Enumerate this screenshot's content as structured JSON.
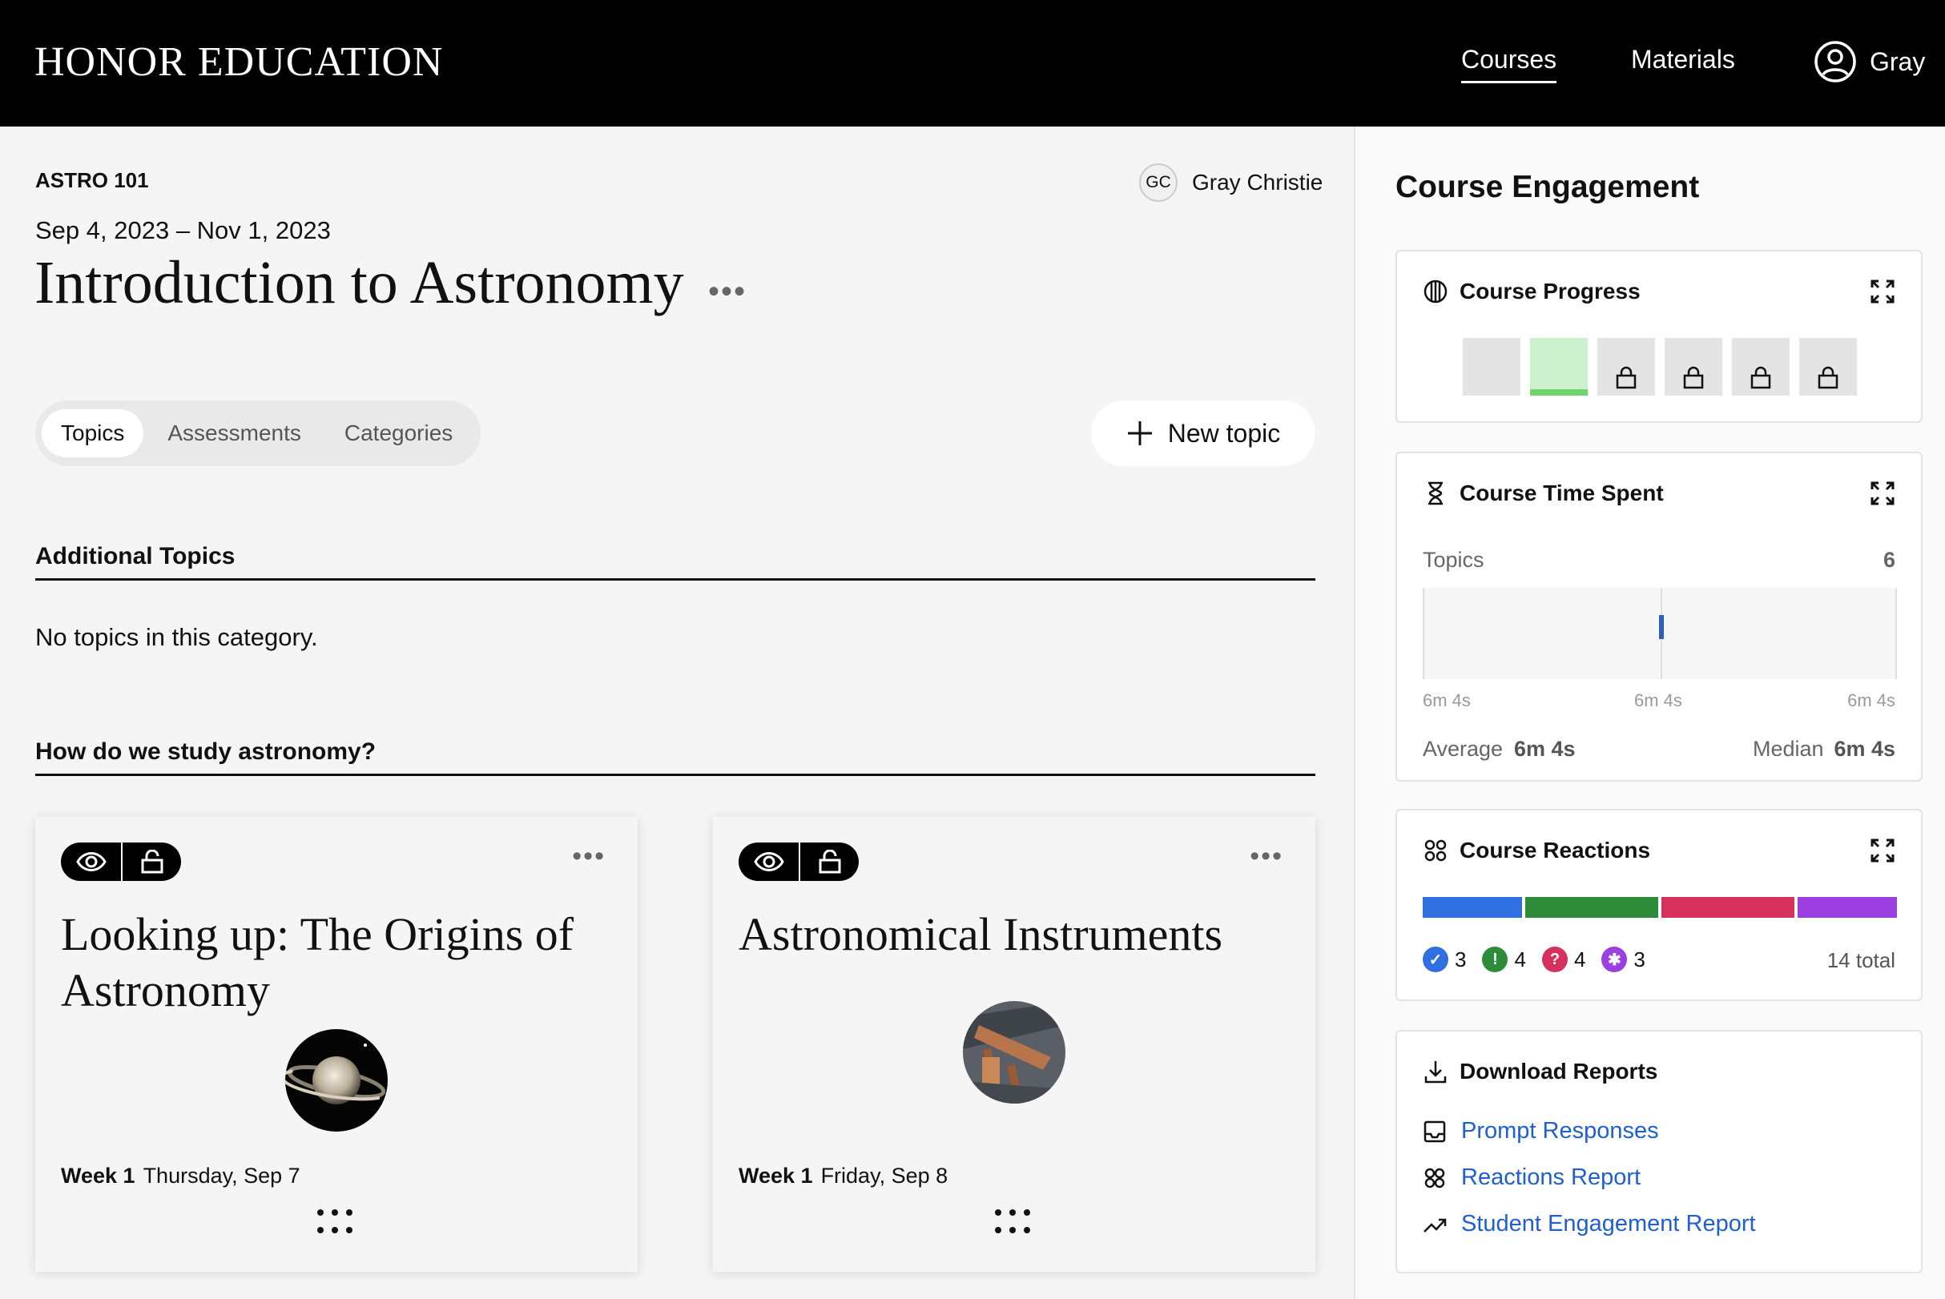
{
  "header": {
    "brand": "HONOR EDUCATION",
    "nav": {
      "courses": "Courses",
      "materials": "Materials",
      "user": "Gray"
    }
  },
  "course": {
    "code": "ASTRO 101",
    "dates": "Sep 4, 2023 – Nov 1, 2023",
    "title": "Introduction to Astronomy",
    "more": "•••",
    "instructor": {
      "initials": "GC",
      "name": "Gray Christie"
    }
  },
  "tabs": [
    "Topics",
    "Assessments",
    "Categories"
  ],
  "new_topic_label": "New topic",
  "sections": [
    {
      "heading": "Additional Topics",
      "empty": "No topics in this category."
    },
    {
      "heading": "How do we study astronomy?"
    }
  ],
  "cards": [
    {
      "title": "Looking up: The Origins of Astronomy",
      "week": "Week 1",
      "date": "Thursday, Sep 7",
      "more": "•••",
      "thumb": "saturn-image"
    },
    {
      "title": "Astronomical Instruments",
      "week": "Week 1",
      "date": "Friday, Sep 8",
      "more": "•••",
      "thumb": "telescope-image"
    }
  ],
  "engagement": {
    "title": "Course Engagement",
    "progress": {
      "title": "Course Progress",
      "steps": [
        "not-started",
        "completed",
        "locked",
        "locked",
        "locked",
        "locked"
      ]
    },
    "time_spent": {
      "title": "Course Time Spent",
      "label": "Topics",
      "count": "6",
      "ticks": [
        "6m 4s",
        "6m 4s",
        "6m 4s"
      ],
      "average_label": "Average",
      "average": "6m 4s",
      "median_label": "Median",
      "median": "6m 4s"
    },
    "reactions": {
      "title": "Course Reactions",
      "items": [
        {
          "icon": "check-icon",
          "color": "#2f6fe0",
          "count": "3"
        },
        {
          "icon": "exclamation-icon",
          "color": "#2e8b3a",
          "count": "4"
        },
        {
          "icon": "question-icon",
          "color": "#d6305c",
          "count": "4"
        },
        {
          "icon": "asterisk-icon",
          "color": "#9b3fe0",
          "count": "3"
        }
      ],
      "total": "14 total"
    },
    "reports": {
      "title": "Download Reports",
      "links": [
        "Prompt Responses",
        "Reactions Report",
        "Student Engagement Report"
      ]
    }
  }
}
